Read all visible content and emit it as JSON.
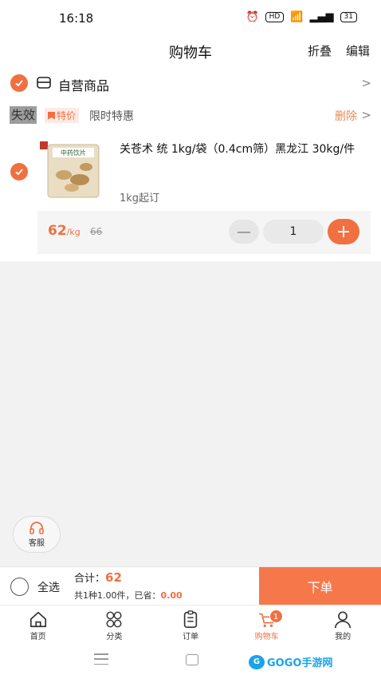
{
  "status_bar": {
    "time": "16:18",
    "network": "HD",
    "battery": "31"
  },
  "header": {
    "title": "购物车",
    "fold_label": "折叠",
    "edit_label": "编辑"
  },
  "store": {
    "name": "自营商品"
  },
  "promo": {
    "invalid_label": "失效",
    "tag_label": "特价",
    "text": "限时特惠",
    "delete_label": "删除"
  },
  "product": {
    "image_label": "中药饮片",
    "name": "关苍术 统 1kg/袋（0.4cm筛）黑龙江 30kg/件",
    "min_order": "1kg起订",
    "price": "62",
    "price_unit": "/kg",
    "original_price": "66",
    "quantity": "1",
    "minus_symbol": "—",
    "plus_symbol": "+"
  },
  "service": {
    "label": "客服"
  },
  "bottom_bar": {
    "select_all_label": "全选",
    "total_label": "合计：",
    "total_value": "62",
    "summary_prefix": "共1种1.00件，已省：",
    "saved_value": "0.00",
    "order_label": "下单"
  },
  "tabs": [
    {
      "label": "首页",
      "icon": "home-icon"
    },
    {
      "label": "分类",
      "icon": "category-icon"
    },
    {
      "label": "订单",
      "icon": "order-icon"
    },
    {
      "label": "购物车",
      "icon": "cart-icon",
      "badge": "1",
      "active": true
    },
    {
      "label": "我的",
      "icon": "profile-icon"
    }
  ],
  "watermark": {
    "logo": "G",
    "text": "GOGO手游网"
  },
  "colors": {
    "accent": "#f07041",
    "order_button": "#f6784a",
    "badge_bg": "#fdeae4"
  }
}
